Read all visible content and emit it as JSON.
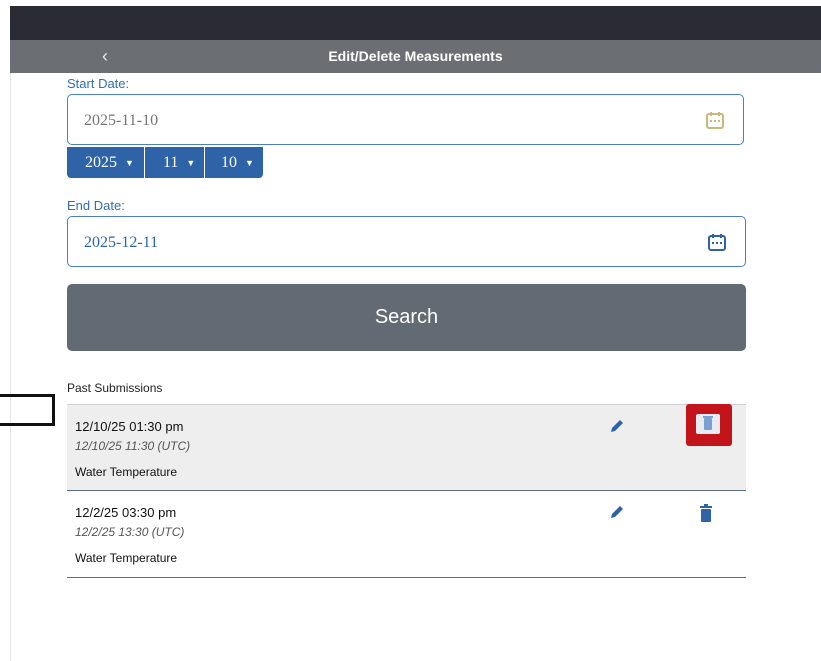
{
  "header": {
    "title": "Edit/Delete Measurements",
    "back_icon": "chevron-left-icon",
    "back_glyph": "‹"
  },
  "start_date": {
    "label": "Start Date:",
    "value": "",
    "placeholder": "2025-11-10",
    "picker": {
      "year": "2025",
      "month": "11",
      "day": "10"
    }
  },
  "end_date": {
    "label": "End Date:",
    "value": "2025-12-11"
  },
  "search": {
    "label": "Search"
  },
  "past": {
    "title": "Past Submissions",
    "items": [
      {
        "datetime": "12/10/25 01:30 pm",
        "utc": "12/10/25 11:30 (UTC)",
        "type": "Water Temperature",
        "selected": true
      },
      {
        "datetime": "12/2/25 03:30 pm",
        "utc": "12/2/25 13:30 (UTC)",
        "type": "Water Temperature",
        "selected": false
      }
    ]
  },
  "colors": {
    "accent": "#2f63a8",
    "label_blue": "#2f6fb3",
    "header_bg": "#6b6f73",
    "search_bg": "#626a73",
    "highlight_red": "#c3141c",
    "selected_row_bg": "#eeeeee"
  }
}
